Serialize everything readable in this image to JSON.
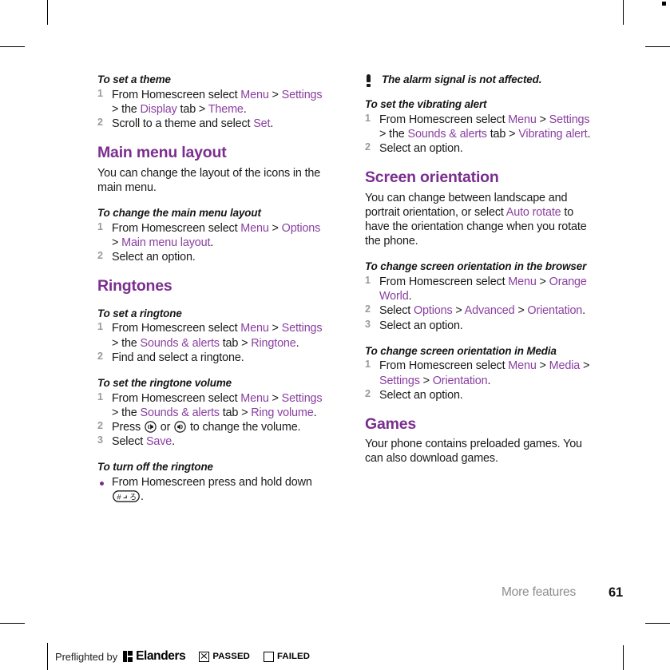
{
  "document": {
    "footer_section": "More features",
    "page_number": "61"
  },
  "left_column": [
    {
      "type": "procedure",
      "heading": "To set a theme",
      "list": "ordered",
      "steps": [
        {
          "runs": [
            {
              "t": "From Homescreen select ",
              "style": "plain"
            },
            {
              "t": "Menu",
              "style": "link"
            },
            {
              "t": " > ",
              "style": "plain"
            },
            {
              "t": "Settings",
              "style": "link"
            },
            {
              "t": " > the ",
              "style": "plain"
            },
            {
              "t": "Display",
              "style": "link"
            },
            {
              "t": " tab > ",
              "style": "plain"
            },
            {
              "t": "Theme",
              "style": "link"
            },
            {
              "t": ".",
              "style": "plain"
            }
          ]
        },
        {
          "runs": [
            {
              "t": "Scroll to a theme and select ",
              "style": "plain"
            },
            {
              "t": "Set",
              "style": "link"
            },
            {
              "t": ".",
              "style": "plain"
            }
          ]
        }
      ]
    },
    {
      "type": "section",
      "title": "Main menu layout",
      "intro": "You can change the layout of the icons in the main menu."
    },
    {
      "type": "procedure",
      "heading": "To change the main menu layout",
      "list": "ordered",
      "steps": [
        {
          "runs": [
            {
              "t": "From Homescreen select ",
              "style": "plain"
            },
            {
              "t": "Menu",
              "style": "link"
            },
            {
              "t": " > ",
              "style": "plain"
            },
            {
              "t": "Options",
              "style": "link"
            },
            {
              "t": " > ",
              "style": "plain"
            },
            {
              "t": "Main menu layout",
              "style": "link"
            },
            {
              "t": ".",
              "style": "plain"
            }
          ]
        },
        {
          "runs": [
            {
              "t": "Select an option.",
              "style": "plain"
            }
          ]
        }
      ]
    },
    {
      "type": "section",
      "title": "Ringtones",
      "intro": ""
    },
    {
      "type": "procedure",
      "heading": "To set a ringtone",
      "list": "ordered",
      "steps": [
        {
          "runs": [
            {
              "t": "From Homescreen select ",
              "style": "plain"
            },
            {
              "t": "Menu",
              "style": "link"
            },
            {
              "t": " > ",
              "style": "plain"
            },
            {
              "t": "Settings",
              "style": "link"
            },
            {
              "t": " > the ",
              "style": "plain"
            },
            {
              "t": "Sounds & alerts",
              "style": "link"
            },
            {
              "t": " tab > ",
              "style": "plain"
            },
            {
              "t": "Ringtone",
              "style": "link"
            },
            {
              "t": ".",
              "style": "plain"
            }
          ]
        },
        {
          "runs": [
            {
              "t": "Find and select a ringtone.",
              "style": "plain"
            }
          ]
        }
      ]
    },
    {
      "type": "procedure",
      "heading": "To set the ringtone volume",
      "list": "ordered",
      "steps": [
        {
          "runs": [
            {
              "t": "From Homescreen select ",
              "style": "plain"
            },
            {
              "t": "Menu",
              "style": "link"
            },
            {
              "t": " > ",
              "style": "plain"
            },
            {
              "t": "Settings",
              "style": "link"
            },
            {
              "t": " > the ",
              "style": "plain"
            },
            {
              "t": "Sounds & alerts",
              "style": "link"
            },
            {
              "t": " tab > ",
              "style": "plain"
            },
            {
              "t": "Ring volume",
              "style": "link"
            },
            {
              "t": ".",
              "style": "plain"
            }
          ]
        },
        {
          "runs": [
            {
              "t": "Press ",
              "style": "plain"
            },
            {
              "t": "volume-down-key-icon",
              "style": "icon"
            },
            {
              "t": " or ",
              "style": "plain"
            },
            {
              "t": "volume-up-key-icon",
              "style": "icon"
            },
            {
              "t": " to change the volume.",
              "style": "plain"
            }
          ]
        },
        {
          "runs": [
            {
              "t": "Select ",
              "style": "plain"
            },
            {
              "t": "Save",
              "style": "link"
            },
            {
              "t": ".",
              "style": "plain"
            }
          ]
        }
      ]
    },
    {
      "type": "procedure",
      "heading": "To turn off the ringtone",
      "list": "bulleted",
      "steps": [
        {
          "runs": [
            {
              "t": "From Homescreen press and hold down ",
              "style": "plain"
            },
            {
              "t": "hash-key-icon",
              "style": "icon"
            },
            {
              "t": ".",
              "style": "plain"
            }
          ]
        }
      ]
    }
  ],
  "right_column": [
    {
      "type": "note",
      "icon": "exclamation-icon",
      "text": "The alarm signal is not affected."
    },
    {
      "type": "procedure",
      "heading": "To set the vibrating alert",
      "list": "ordered",
      "steps": [
        {
          "runs": [
            {
              "t": "From Homescreen select ",
              "style": "plain"
            },
            {
              "t": "Menu",
              "style": "link"
            },
            {
              "t": " > ",
              "style": "plain"
            },
            {
              "t": "Settings",
              "style": "link"
            },
            {
              "t": " > the ",
              "style": "plain"
            },
            {
              "t": "Sounds & alerts",
              "style": "link"
            },
            {
              "t": " tab > ",
              "style": "plain"
            },
            {
              "t": "Vibrating alert",
              "style": "link"
            },
            {
              "t": ".",
              "style": "plain"
            }
          ]
        },
        {
          "runs": [
            {
              "t": "Select an option.",
              "style": "plain"
            }
          ]
        }
      ]
    },
    {
      "type": "section",
      "title": "Screen orientation",
      "intro_runs": [
        {
          "t": "You can change between landscape and portrait orientation, or select ",
          "style": "plain"
        },
        {
          "t": "Auto rotate",
          "style": "link"
        },
        {
          "t": " to have the orientation change when you rotate the phone.",
          "style": "plain"
        }
      ]
    },
    {
      "type": "procedure",
      "heading": "To change screen orientation in the browser",
      "list": "ordered",
      "steps": [
        {
          "runs": [
            {
              "t": "From Homescreen select ",
              "style": "plain"
            },
            {
              "t": "Menu",
              "style": "link"
            },
            {
              "t": " > ",
              "style": "plain"
            },
            {
              "t": "Orange World",
              "style": "link"
            },
            {
              "t": ".",
              "style": "plain"
            }
          ]
        },
        {
          "runs": [
            {
              "t": "Select ",
              "style": "plain"
            },
            {
              "t": "Options",
              "style": "link"
            },
            {
              "t": " > ",
              "style": "plain"
            },
            {
              "t": "Advanced",
              "style": "link"
            },
            {
              "t": " > ",
              "style": "plain"
            },
            {
              "t": "Orientation",
              "style": "link"
            },
            {
              "t": ".",
              "style": "plain"
            }
          ]
        },
        {
          "runs": [
            {
              "t": "Select an option.",
              "style": "plain"
            }
          ]
        }
      ]
    },
    {
      "type": "procedure",
      "heading": "To change screen orientation in Media",
      "list": "ordered",
      "steps": [
        {
          "runs": [
            {
              "t": "From Homescreen select ",
              "style": "plain"
            },
            {
              "t": "Menu",
              "style": "link"
            },
            {
              "t": " > ",
              "style": "plain"
            },
            {
              "t": "Media",
              "style": "link"
            },
            {
              "t": " > ",
              "style": "plain"
            },
            {
              "t": "Settings",
              "style": "link"
            },
            {
              "t": " > ",
              "style": "plain"
            },
            {
              "t": "Orientation",
              "style": "link"
            },
            {
              "t": ".",
              "style": "plain"
            }
          ]
        },
        {
          "runs": [
            {
              "t": "Select an option.",
              "style": "plain"
            }
          ]
        }
      ]
    },
    {
      "type": "section",
      "title": "Games",
      "intro": "Your phone contains preloaded games. You can also download games."
    }
  ],
  "preflight": {
    "prefix": "Preflighted by",
    "brand": "Elanders",
    "passed_label": "PASSED",
    "failed_label": "FAILED",
    "passed_checked": true,
    "failed_checked": false
  },
  "colors": {
    "heading_purple": "#7a2e8e",
    "link_purple": "#8a3fa0",
    "body_black": "#1a1a1a",
    "step_number_gray": "#9a9a9a",
    "footer_gray": "#8c8c8c"
  }
}
